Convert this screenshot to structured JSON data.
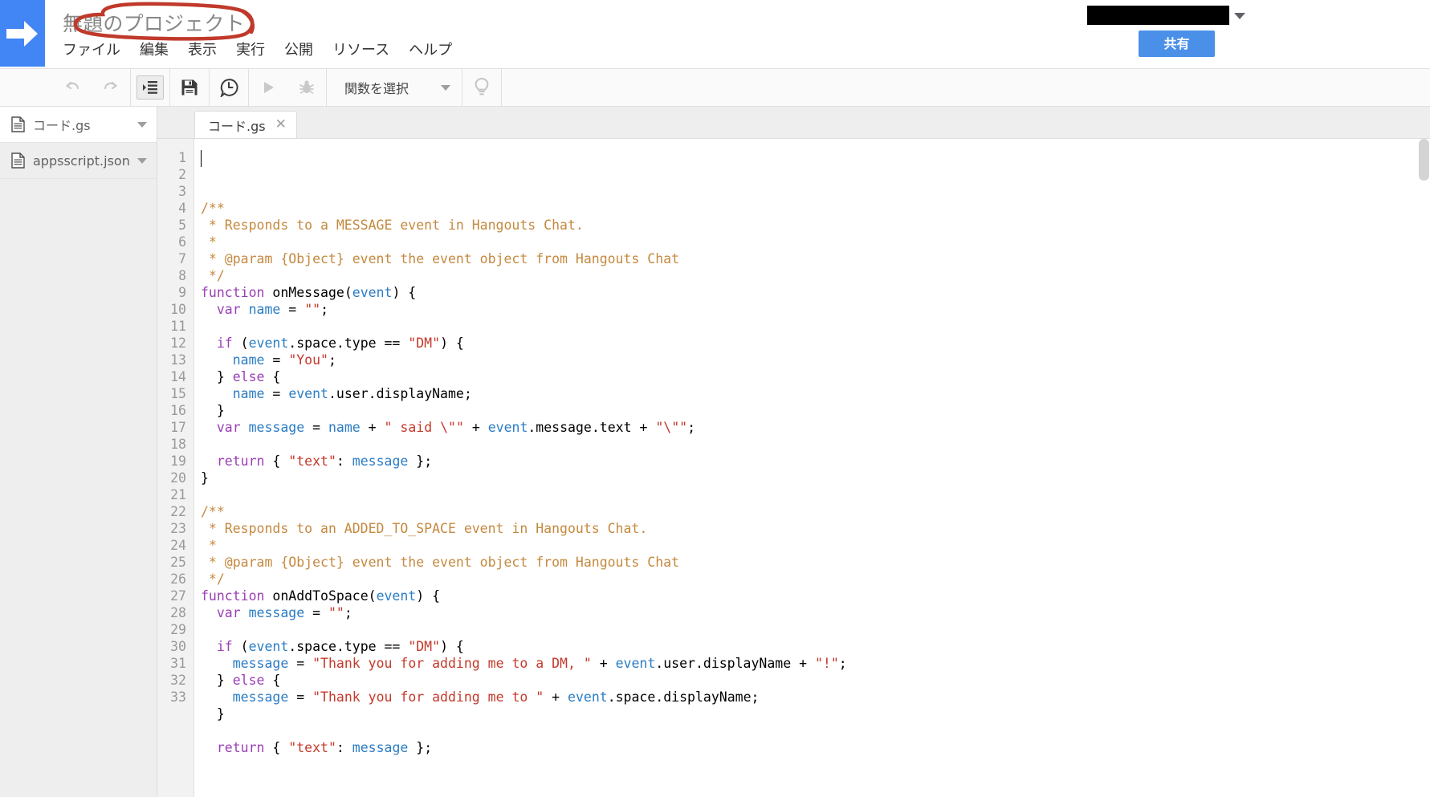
{
  "header": {
    "logo_icon": "right-arrow-icon",
    "project_title": "無題のプロジェクト",
    "account_caret_icon": "chevron-down-icon",
    "share_label": "共有",
    "menu": [
      {
        "label": "ファイル"
      },
      {
        "label": "編集"
      },
      {
        "label": "表示"
      },
      {
        "label": "実行"
      },
      {
        "label": "公開"
      },
      {
        "label": "リソース"
      },
      {
        "label": "ヘルプ"
      }
    ]
  },
  "annotation": {
    "color": "#c0392b",
    "shape": "hand-drawn-ellipse",
    "target": "無題のプロジェクト"
  },
  "toolbar": {
    "buttons": [
      {
        "name": "undo-icon",
        "title": "元に戻す",
        "disabled": true
      },
      {
        "name": "redo-icon",
        "title": "やり直し",
        "disabled": true
      },
      {
        "name": "indent-icon",
        "title": "インデント",
        "disabled": false,
        "active": true
      },
      {
        "name": "save-icon",
        "title": "保存",
        "disabled": false
      },
      {
        "name": "history-icon",
        "title": "履歴",
        "disabled": false
      },
      {
        "name": "run-icon",
        "title": "実行",
        "disabled": true
      },
      {
        "name": "debug-icon",
        "title": "デバッグ",
        "disabled": true
      }
    ],
    "function_select_label": "関数を選択",
    "function_select_caret": "chevron-down-icon",
    "hint_icon": "lightbulb-icon"
  },
  "sidebar": {
    "files": [
      {
        "label": "コード.gs",
        "icon": "file-icon",
        "caret": "chevron-down-icon",
        "selected": true
      },
      {
        "label": "appsscript.json",
        "icon": "file-icon",
        "caret": "chevron-down-icon",
        "selected": false
      }
    ]
  },
  "editor": {
    "tabs": [
      {
        "label": "コード.gs",
        "close_icon": "close-icon",
        "active": true
      }
    ],
    "line_numbers": [
      1,
      2,
      3,
      4,
      5,
      6,
      7,
      8,
      9,
      10,
      11,
      12,
      13,
      14,
      15,
      16,
      17,
      18,
      19,
      20,
      21,
      22,
      23,
      24,
      25,
      26,
      27,
      28,
      29,
      30,
      31,
      32,
      33
    ],
    "lines": [
      [
        {
          "t": "/**",
          "c": "com"
        }
      ],
      [
        {
          "t": " * Responds to a MESSAGE event in Hangouts Chat.",
          "c": "com"
        }
      ],
      [
        {
          "t": " *",
          "c": "com"
        }
      ],
      [
        {
          "t": " * @param {Object} event the event object from Hangouts Chat",
          "c": "com"
        }
      ],
      [
        {
          "t": " */",
          "c": "com"
        }
      ],
      [
        {
          "t": "function",
          "c": "kw"
        },
        {
          "t": " onMessage(",
          "c": "plain"
        },
        {
          "t": "event",
          "c": "var"
        },
        {
          "t": ") {",
          "c": "plain"
        }
      ],
      [
        {
          "t": "  ",
          "c": "plain"
        },
        {
          "t": "var",
          "c": "kw"
        },
        {
          "t": " ",
          "c": "plain"
        },
        {
          "t": "name",
          "c": "var"
        },
        {
          "t": " = ",
          "c": "plain"
        },
        {
          "t": "\"\"",
          "c": "str"
        },
        {
          "t": ";",
          "c": "plain"
        }
      ],
      [
        {
          "t": "",
          "c": "plain"
        }
      ],
      [
        {
          "t": "  ",
          "c": "plain"
        },
        {
          "t": "if",
          "c": "kw"
        },
        {
          "t": " (",
          "c": "plain"
        },
        {
          "t": "event",
          "c": "var"
        },
        {
          "t": ".space.type == ",
          "c": "plain"
        },
        {
          "t": "\"DM\"",
          "c": "str"
        },
        {
          "t": ") {",
          "c": "plain"
        }
      ],
      [
        {
          "t": "    ",
          "c": "plain"
        },
        {
          "t": "name",
          "c": "var"
        },
        {
          "t": " = ",
          "c": "plain"
        },
        {
          "t": "\"You\"",
          "c": "str"
        },
        {
          "t": ";",
          "c": "plain"
        }
      ],
      [
        {
          "t": "  } ",
          "c": "plain"
        },
        {
          "t": "else",
          "c": "kw"
        },
        {
          "t": " {",
          "c": "plain"
        }
      ],
      [
        {
          "t": "    ",
          "c": "plain"
        },
        {
          "t": "name",
          "c": "var"
        },
        {
          "t": " = ",
          "c": "plain"
        },
        {
          "t": "event",
          "c": "var"
        },
        {
          "t": ".user.displayName;",
          "c": "plain"
        }
      ],
      [
        {
          "t": "  }",
          "c": "plain"
        }
      ],
      [
        {
          "t": "  ",
          "c": "plain"
        },
        {
          "t": "var",
          "c": "kw"
        },
        {
          "t": " ",
          "c": "plain"
        },
        {
          "t": "message",
          "c": "var"
        },
        {
          "t": " = ",
          "c": "plain"
        },
        {
          "t": "name",
          "c": "var"
        },
        {
          "t": " + ",
          "c": "plain"
        },
        {
          "t": "\" said \\\"\"",
          "c": "str"
        },
        {
          "t": " + ",
          "c": "plain"
        },
        {
          "t": "event",
          "c": "var"
        },
        {
          "t": ".message.text + ",
          "c": "plain"
        },
        {
          "t": "\"\\\"\"",
          "c": "str"
        },
        {
          "t": ";",
          "c": "plain"
        }
      ],
      [
        {
          "t": "",
          "c": "plain"
        }
      ],
      [
        {
          "t": "  ",
          "c": "plain"
        },
        {
          "t": "return",
          "c": "kw"
        },
        {
          "t": " { ",
          "c": "plain"
        },
        {
          "t": "\"text\"",
          "c": "str"
        },
        {
          "t": ": ",
          "c": "plain"
        },
        {
          "t": "message",
          "c": "var"
        },
        {
          "t": " };",
          "c": "plain"
        }
      ],
      [
        {
          "t": "}",
          "c": "plain"
        }
      ],
      [
        {
          "t": "",
          "c": "plain"
        }
      ],
      [
        {
          "t": "/**",
          "c": "com"
        }
      ],
      [
        {
          "t": " * Responds to an ADDED_TO_SPACE event in Hangouts Chat.",
          "c": "com"
        }
      ],
      [
        {
          "t": " *",
          "c": "com"
        }
      ],
      [
        {
          "t": " * @param {Object} event the event object from Hangouts Chat",
          "c": "com"
        }
      ],
      [
        {
          "t": " */",
          "c": "com"
        }
      ],
      [
        {
          "t": "function",
          "c": "kw"
        },
        {
          "t": " onAddToSpace(",
          "c": "plain"
        },
        {
          "t": "event",
          "c": "var"
        },
        {
          "t": ") {",
          "c": "plain"
        }
      ],
      [
        {
          "t": "  ",
          "c": "plain"
        },
        {
          "t": "var",
          "c": "kw"
        },
        {
          "t": " ",
          "c": "plain"
        },
        {
          "t": "message",
          "c": "var"
        },
        {
          "t": " = ",
          "c": "plain"
        },
        {
          "t": "\"\"",
          "c": "str"
        },
        {
          "t": ";",
          "c": "plain"
        }
      ],
      [
        {
          "t": "",
          "c": "plain"
        }
      ],
      [
        {
          "t": "  ",
          "c": "plain"
        },
        {
          "t": "if",
          "c": "kw"
        },
        {
          "t": " (",
          "c": "plain"
        },
        {
          "t": "event",
          "c": "var"
        },
        {
          "t": ".space.type == ",
          "c": "plain"
        },
        {
          "t": "\"DM\"",
          "c": "str"
        },
        {
          "t": ") {",
          "c": "plain"
        }
      ],
      [
        {
          "t": "    ",
          "c": "plain"
        },
        {
          "t": "message",
          "c": "var"
        },
        {
          "t": " = ",
          "c": "plain"
        },
        {
          "t": "\"Thank you for adding me to a DM, \"",
          "c": "str"
        },
        {
          "t": " + ",
          "c": "plain"
        },
        {
          "t": "event",
          "c": "var"
        },
        {
          "t": ".user.displayName + ",
          "c": "plain"
        },
        {
          "t": "\"!\"",
          "c": "str"
        },
        {
          "t": ";",
          "c": "plain"
        }
      ],
      [
        {
          "t": "  } ",
          "c": "plain"
        },
        {
          "t": "else",
          "c": "kw"
        },
        {
          "t": " {",
          "c": "plain"
        }
      ],
      [
        {
          "t": "    ",
          "c": "plain"
        },
        {
          "t": "message",
          "c": "var"
        },
        {
          "t": " = ",
          "c": "plain"
        },
        {
          "t": "\"Thank you for adding me to \"",
          "c": "str"
        },
        {
          "t": " + ",
          "c": "plain"
        },
        {
          "t": "event",
          "c": "var"
        },
        {
          "t": ".space.displayName;",
          "c": "plain"
        }
      ],
      [
        {
          "t": "  }",
          "c": "plain"
        }
      ],
      [
        {
          "t": "",
          "c": "plain"
        }
      ],
      [
        {
          "t": "  ",
          "c": "plain"
        },
        {
          "t": "return",
          "c": "kw"
        },
        {
          "t": " { ",
          "c": "plain"
        },
        {
          "t": "\"text\"",
          "c": "str"
        },
        {
          "t": ": ",
          "c": "plain"
        },
        {
          "t": "message",
          "c": "var"
        },
        {
          "t": " };",
          "c": "plain"
        }
      ]
    ]
  },
  "colors": {
    "brand_blue": "#4285f4",
    "share_blue": "#4a90e8",
    "comment": "#c5893f",
    "keyword": "#9a3fb5",
    "string": "#c4392b",
    "variable": "#2b7cc4",
    "annotation_red": "#c0392b"
  }
}
